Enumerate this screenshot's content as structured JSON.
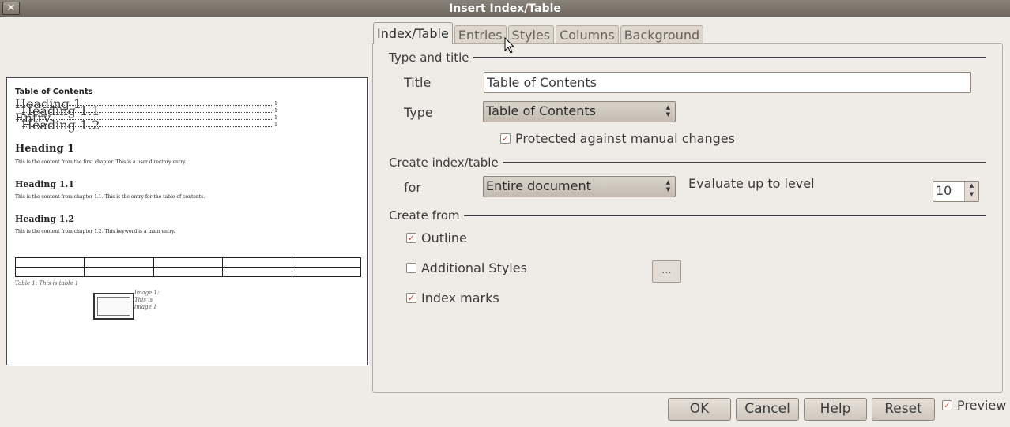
{
  "window": {
    "title": "Insert Index/Table",
    "close_label": "✕"
  },
  "preview": {
    "toc_title": "Table of Contents",
    "toc_rows": [
      {
        "label": "Heading 1",
        "page": "1"
      },
      {
        "label": "Heading 1.1",
        "page": "1"
      },
      {
        "label": "Entry",
        "page": "1"
      },
      {
        "label": "Heading 1.2",
        "page": "1"
      }
    ],
    "h1": "Heading 1",
    "p1": "This is the content from the first chapter. This is a user directory entry.",
    "h11": "Heading 1.1",
    "p11": "This is the content from chapter 1.1. This is the entry for the table of contents.",
    "h12": "Heading 1.2",
    "p12": "This is the content from chapter 1.2. This keyword is a main entry.",
    "table_caption": "Table 1: This is table 1",
    "image_caption": "Image 1: This is image 1"
  },
  "tabs": [
    "Index/Table",
    "Entries",
    "Styles",
    "Columns",
    "Background"
  ],
  "type_and_title": {
    "header": "Type and title",
    "title_label": "Title",
    "title_value": "Table of Contents",
    "type_label": "Type",
    "type_value": "Table of Contents",
    "protected_label": "Protected against manual changes",
    "protected_checked": true
  },
  "create_index": {
    "header": "Create index/table",
    "for_label": "for",
    "for_value": "Entire document",
    "evaluate_label": "Evaluate up to level",
    "level_value": "10"
  },
  "create_from": {
    "header": "Create from",
    "outline_label": "Outline",
    "outline_checked": true,
    "additional_label": "Additional Styles",
    "additional_checked": false,
    "additional_button": "...",
    "index_marks_label": "Index marks",
    "index_marks_checked": true
  },
  "footer": {
    "ok": "OK",
    "cancel": "Cancel",
    "help": "Help",
    "reset": "Reset",
    "preview_label": "Preview",
    "preview_checked": true
  }
}
